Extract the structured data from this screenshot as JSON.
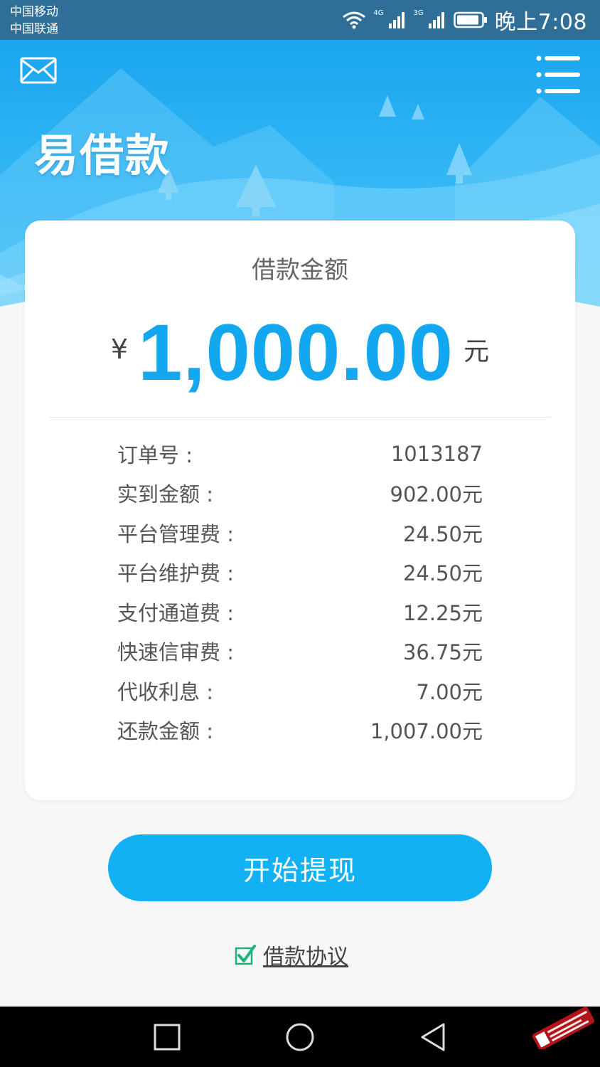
{
  "status_bar": {
    "carrier_1": "中国移动",
    "carrier_2": "中国联通",
    "signal_1_label": "4G",
    "signal_2_label": "3G",
    "time": "晚上7:08"
  },
  "header": {
    "app_title": "易借款",
    "mail_icon": "mail-icon",
    "menu_icon": "menu-icon"
  },
  "loan_card": {
    "label": "借款金额",
    "currency_symbol": "¥",
    "amount": "1,000.00",
    "unit": "元",
    "details": [
      {
        "label": "订单号 :",
        "value": "1013187"
      },
      {
        "label": "实到金额 :",
        "value": "902.00元"
      },
      {
        "label": "平台管理费 :",
        "value": "24.50元"
      },
      {
        "label": "平台维护费 :",
        "value": "24.50元"
      },
      {
        "label": "支付通道费 :",
        "value": "12.25元"
      },
      {
        "label": "快速信审费 :",
        "value": "36.75元"
      },
      {
        "label": "代收利息 :",
        "value": "7.00元"
      },
      {
        "label": "还款金额 :",
        "value": "1,007.00元"
      }
    ]
  },
  "actions": {
    "withdraw_label": "开始提现",
    "agreement_label": "借款协议",
    "agreement_checked": true
  },
  "nav_bar": {
    "recent_icon": "square-icon",
    "home_icon": "circle-icon",
    "back_icon": "triangle-back-icon"
  },
  "colors": {
    "accent": "#12b1f4",
    "header_blue": "#1aa5ee",
    "check_green": "#1fb37a"
  }
}
